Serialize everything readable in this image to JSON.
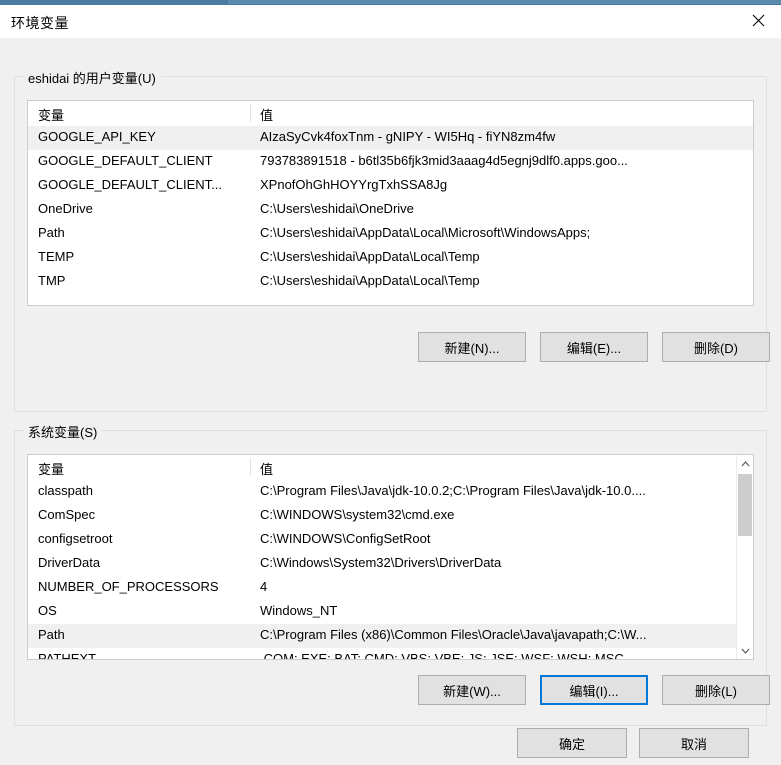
{
  "window": {
    "title": "环境变量",
    "close_icon": "close-icon"
  },
  "user_section": {
    "label": "eshidai 的用户变量(U)",
    "columns": [
      "变量",
      "值"
    ],
    "rows": [
      {
        "name": "GOOGLE_API_KEY",
        "value": "AIzaSyCvk4foxTnm - gNIPY - WI5Hq - fiYN8zm4fw",
        "selected": true
      },
      {
        "name": "GOOGLE_DEFAULT_CLIENT",
        "value": "793783891518 - b6tl35b6fjk3mid3aaag4d5egnj9dlf0.apps.goo...",
        "selected": false
      },
      {
        "name": "GOOGLE_DEFAULT_CLIENT...",
        "value": "XPnofOhGhHOYYrgTxhSSA8Jg",
        "selected": false
      },
      {
        "name": "OneDrive",
        "value": "C:\\Users\\eshidai\\OneDrive",
        "selected": false
      },
      {
        "name": "Path",
        "value": "C:\\Users\\eshidai\\AppData\\Local\\Microsoft\\WindowsApps;",
        "selected": false
      },
      {
        "name": "TEMP",
        "value": "C:\\Users\\eshidai\\AppData\\Local\\Temp",
        "selected": false
      },
      {
        "name": "TMP",
        "value": "C:\\Users\\eshidai\\AppData\\Local\\Temp",
        "selected": false
      }
    ],
    "buttons": {
      "new": "新建(N)...",
      "edit": "编辑(E)...",
      "delete": "删除(D)"
    }
  },
  "system_section": {
    "label": "系统变量(S)",
    "columns": [
      "变量",
      "值"
    ],
    "rows": [
      {
        "name": "classpath",
        "value": "C:\\Program Files\\Java\\jdk-10.0.2;C:\\Program Files\\Java\\jdk-10.0....",
        "selected": false
      },
      {
        "name": "ComSpec",
        "value": "C:\\WINDOWS\\system32\\cmd.exe",
        "selected": false
      },
      {
        "name": "configsetroot",
        "value": "C:\\WINDOWS\\ConfigSetRoot",
        "selected": false
      },
      {
        "name": "DriverData",
        "value": "C:\\Windows\\System32\\Drivers\\DriverData",
        "selected": false
      },
      {
        "name": "NUMBER_OF_PROCESSORS",
        "value": "4",
        "selected": false
      },
      {
        "name": "OS",
        "value": "Windows_NT",
        "selected": false
      },
      {
        "name": "Path",
        "value": "C:\\Program Files (x86)\\Common Files\\Oracle\\Java\\javapath;C:\\W...",
        "selected": true
      },
      {
        "name": "PATHEXT",
        "value": ".COM;.EXE;.BAT;.CMD;.VBS;.VBE;.JS;.JSE;.WSF;.WSH;.MSC",
        "selected": false
      }
    ],
    "buttons": {
      "new": "新建(W)...",
      "edit": "编辑(I)...",
      "delete": "删除(L)"
    },
    "scrollbar": {
      "up_icon": "chevron-up-icon",
      "down_icon": "chevron-down-icon"
    }
  },
  "footer": {
    "ok": "确定",
    "cancel": "取消"
  },
  "colors": {
    "accent": "#0078d7",
    "selection": "#f0f0f0",
    "dialog_bg": "#f0f0f0",
    "button_bg": "#e1e1e1"
  }
}
